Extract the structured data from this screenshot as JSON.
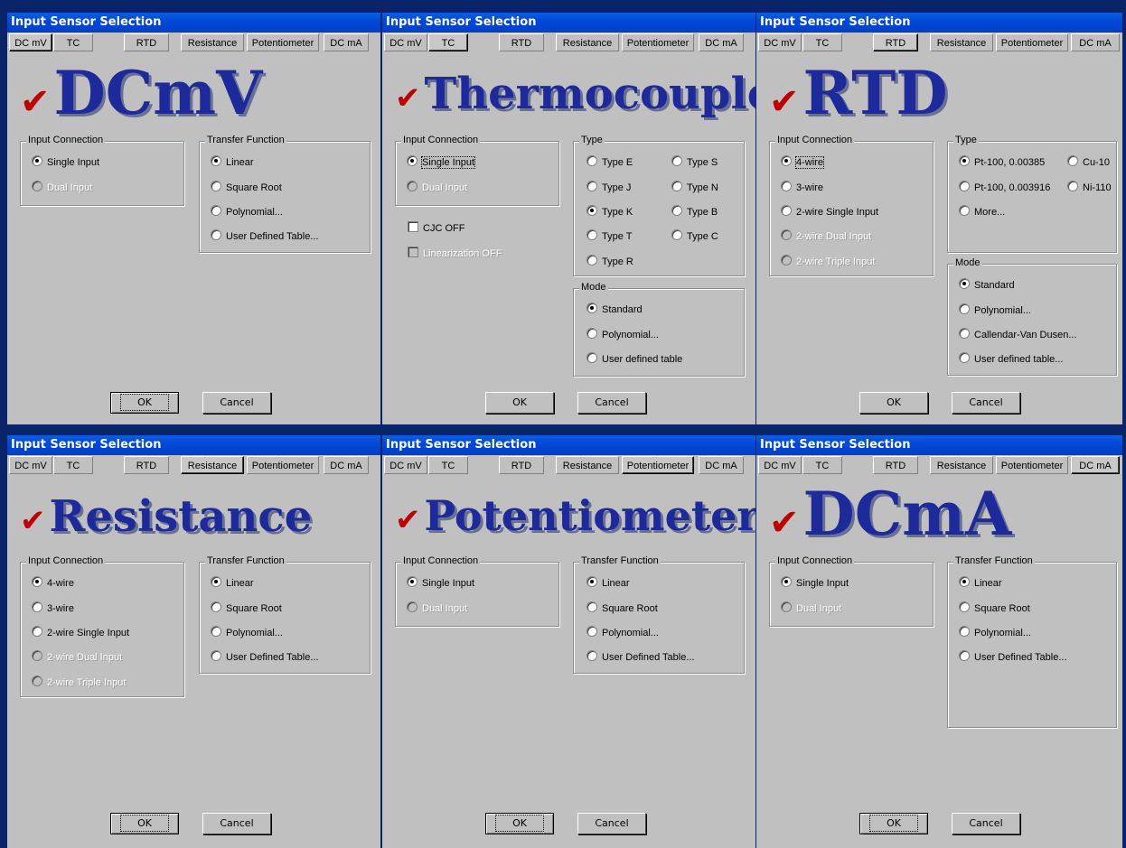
{
  "title": "Input Sensor Selection",
  "tabs": [
    "DC mV",
    "TC",
    "RTD",
    "Resistance",
    "Potentiometer",
    "DC mA"
  ],
  "buttons": {
    "ok": "OK",
    "cancel": "Cancel"
  },
  "groups": {
    "input_connection": "Input Connection",
    "transfer_function": "Transfer Function",
    "type": "Type",
    "mode": "Mode"
  },
  "dialogs": {
    "dcmv": {
      "selected_tab": "DC mV",
      "heading": "DCmV"
    },
    "tc": {
      "selected_tab": "TC",
      "heading": "Thermocouple"
    },
    "rtd": {
      "selected_tab": "RTD",
      "heading": "RTD"
    },
    "resistance": {
      "selected_tab": "Resistance",
      "heading": "Resistance"
    },
    "pot": {
      "selected_tab": "Potentiometer",
      "heading": "Potentiometer"
    },
    "dcma": {
      "selected_tab": "DC mA",
      "heading": "DCmA"
    }
  },
  "options": {
    "single_input": "Single Input",
    "dual_input": "Dual Input",
    "linear": "Linear",
    "square_root": "Square Root",
    "polynomial": "Polynomial...",
    "user_defined_table_tf": "User Defined Table...",
    "four_wire": "4-wire",
    "three_wire": "3-wire",
    "two_wire_single": "2-wire Single Input",
    "two_wire_dual": "2-wire Dual Input",
    "two_wire_triple": "2-wire Triple Input",
    "type_e": "Type E",
    "type_s": "Type S",
    "type_j": "Type J",
    "type_n": "Type N",
    "type_k": "Type K",
    "type_b": "Type B",
    "type_t": "Type T",
    "type_c": "Type C",
    "type_r": "Type R",
    "cjc_off": "CJC OFF",
    "linearization_off": "Linearization OFF",
    "standard": "Standard",
    "user_defined_table_lc": "User defined table",
    "user_defined_table_rtd": "User defined table...",
    "pt100_385": "Pt-100, 0.00385",
    "cu10": "Cu-10",
    "pt100_3916": "Pt-100, 0.003916",
    "ni110": "Ni-110",
    "more": "More...",
    "callendar": "Callendar-Van Dusen..."
  },
  "colors": {
    "dialog_bg": "#c0c0c0",
    "title_bar": "#0049d6",
    "heading": "#1d2a9c",
    "check": "#c00000"
  },
  "icons": [
    "check-icon",
    "radio-icon",
    "checkbox-icon"
  ]
}
